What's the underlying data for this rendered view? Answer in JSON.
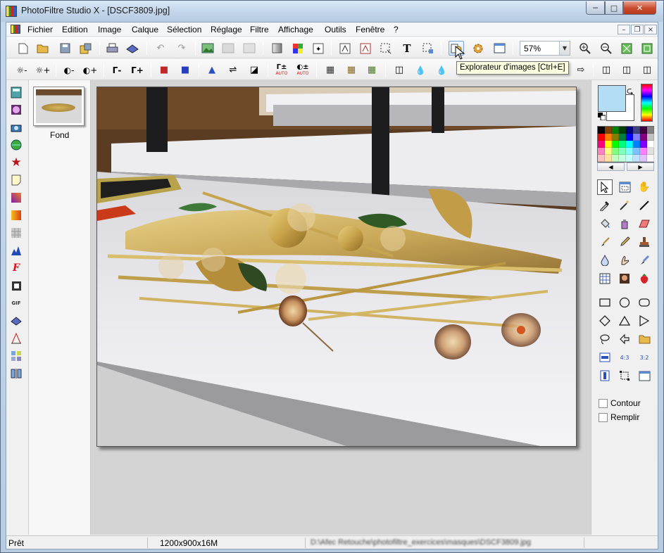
{
  "window": {
    "title": "PhotoFiltre Studio X - [DSCF3809.jpg]",
    "min": "─",
    "max": "□",
    "close": "✕"
  },
  "menu": [
    "Fichier",
    "Edition",
    "Image",
    "Calque",
    "Sélection",
    "Réglage",
    "Filtre",
    "Affichage",
    "Outils",
    "Fenêtre",
    "?"
  ],
  "mdi": {
    "min": "–",
    "restore": "❐",
    "close": "×"
  },
  "toolbar1": {
    "icons": [
      "new-icon",
      "open-icon",
      "save-icon",
      "save-as-icon",
      "print-icon",
      "scan-icon",
      "undo-icon",
      "redo-icon",
      "image-icon",
      "image-dup-icon",
      "image-paste-icon",
      "gradient-icon",
      "rgb-icon",
      "automate-icon",
      "transform-icon",
      "transform-2-icon",
      "selection-icon",
      "text-icon",
      "crop-selection-icon",
      "image-explorer-icon",
      "gear-icon",
      "window-icon"
    ],
    "zoom": "57%"
  },
  "toolbar2": {
    "labels": [
      "☼-",
      "☼+",
      "◐-",
      "◐+",
      "Γ-",
      "Γ+",
      "■",
      "■",
      "▲",
      "⇌",
      "◪",
      "Γ±",
      "◐±",
      "▦",
      "▦",
      "▦",
      "◫",
      "💧",
      "💧",
      "⇨",
      "◫",
      "◫",
      "◫"
    ],
    "auto": "AUTO"
  },
  "tooltip": "Explorateur d'images [Ctrl+E]",
  "left_tools": [
    "calculator-icon",
    "sphere-icon",
    "camera-icon",
    "globe-icon",
    "star-icon",
    "note-icon",
    "gradient-icon",
    "orange-gradient-icon",
    "pattern-icon",
    "levels-icon",
    "font-icon",
    "frame-icon",
    "gif-icon",
    "scanner-icon",
    "perspective-icon",
    "mosaic-icon",
    "split-icon"
  ],
  "layers": {
    "name": "Fond"
  },
  "colors": {
    "foreground": "#b3dcf5",
    "background": "#ffffff",
    "palette": [
      "#000000",
      "#804000",
      "#008000",
      "#004000",
      "#000080",
      "#404080",
      "#400040",
      "#808080",
      "#ff0000",
      "#ff8000",
      "#808000",
      "#008040",
      "#0000ff",
      "#8080ff",
      "#800080",
      "#c0c0c0",
      "#ff0080",
      "#ffff00",
      "#00ff00",
      "#00ff80",
      "#00ffff",
      "#0080ff",
      "#8000ff",
      "#ffffff",
      "#ff80c0",
      "#ffff80",
      "#80ff80",
      "#80ffc0",
      "#80ffff",
      "#80c0ff",
      "#ff80ff",
      "#e0e0e0",
      "#ffc0c0",
      "#ffe0a0",
      "#c0ffc0",
      "#c0ffe0",
      "#c0ffff",
      "#c0e0ff",
      "#e0c0ff",
      "#f8f8f8"
    ]
  },
  "right_tools": [
    "pointer-icon",
    "selection-window-icon",
    "hand-icon",
    "eyedropper-icon",
    "magic-wand-icon",
    "line-icon",
    "fill-icon",
    "spray-icon",
    "eraser-icon",
    "brush-icon",
    "pencil-icon",
    "stamp-icon",
    "drop-icon",
    "finger-icon",
    "blur-brush-icon",
    "grid-icon",
    "portrait-icon",
    "strawberry-icon",
    "rectangle-icon",
    "ellipse-icon",
    "rounded-rect-icon",
    "diamond-icon",
    "triangle-icon",
    "play-icon",
    "lasso-icon",
    "polygon-icon",
    "folder-open-icon",
    "ratio-icon",
    "ratio-43-icon",
    "ratio-32-icon",
    "vertical-ratio-icon",
    "crop-icon",
    "window-icon"
  ],
  "options": {
    "contour": "Contour",
    "remplir": "Remplir"
  },
  "status": {
    "state": "Prêt",
    "size": "1200x900x16M",
    "path": "D:\\Afec Retouche\\photofiltre_exercices\\masques\\DSCF3809.jpg"
  }
}
